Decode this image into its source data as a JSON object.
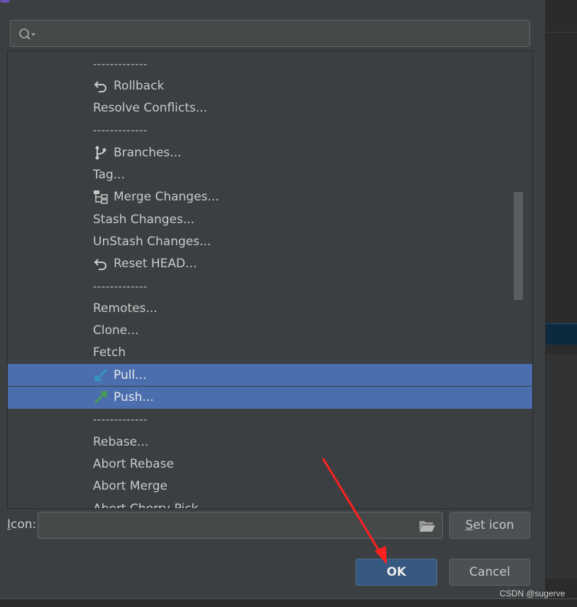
{
  "list": {
    "items": [
      {
        "label": "-------------",
        "type": "separator"
      },
      {
        "label": "Rollback",
        "icon": "rollback-icon"
      },
      {
        "label": "Resolve Conflicts...",
        "icon": ""
      },
      {
        "label": "-------------",
        "type": "separator"
      },
      {
        "label": "Branches...",
        "icon": "branch-icon"
      },
      {
        "label": "Tag...",
        "icon": ""
      },
      {
        "label": "Merge Changes...",
        "icon": "merge-icon"
      },
      {
        "label": "Stash Changes...",
        "icon": ""
      },
      {
        "label": "UnStash Changes...",
        "icon": ""
      },
      {
        "label": "Reset HEAD...",
        "icon": "rollback-icon"
      },
      {
        "label": "-------------",
        "type": "separator"
      },
      {
        "label": "Remotes...",
        "icon": ""
      },
      {
        "label": "Clone...",
        "icon": ""
      },
      {
        "label": "Fetch",
        "icon": ""
      },
      {
        "label": "Pull...",
        "icon": "pull-arrow-icon",
        "selected": true
      },
      {
        "label": "Push...",
        "icon": "push-arrow-icon",
        "selected": true
      },
      {
        "label": "-------------",
        "type": "separator"
      },
      {
        "label": "Rebase...",
        "icon": ""
      },
      {
        "label": "Abort Rebase",
        "icon": ""
      },
      {
        "label": "Abort Merge",
        "icon": ""
      },
      {
        "label": "Abort Cherry-Pick",
        "icon": ""
      }
    ]
  },
  "icon_field": {
    "label_first": "I",
    "label_rest": "con:",
    "value": ""
  },
  "buttons": {
    "set_icon_first": "S",
    "set_icon_rest": "et icon",
    "ok": "OK",
    "cancel": "Cancel"
  },
  "watermark": "CSDN @sugerve",
  "colors": {
    "selection": "#4b6eaf",
    "ok_button": "#365880",
    "annotation_arrow": "#ff2020"
  }
}
